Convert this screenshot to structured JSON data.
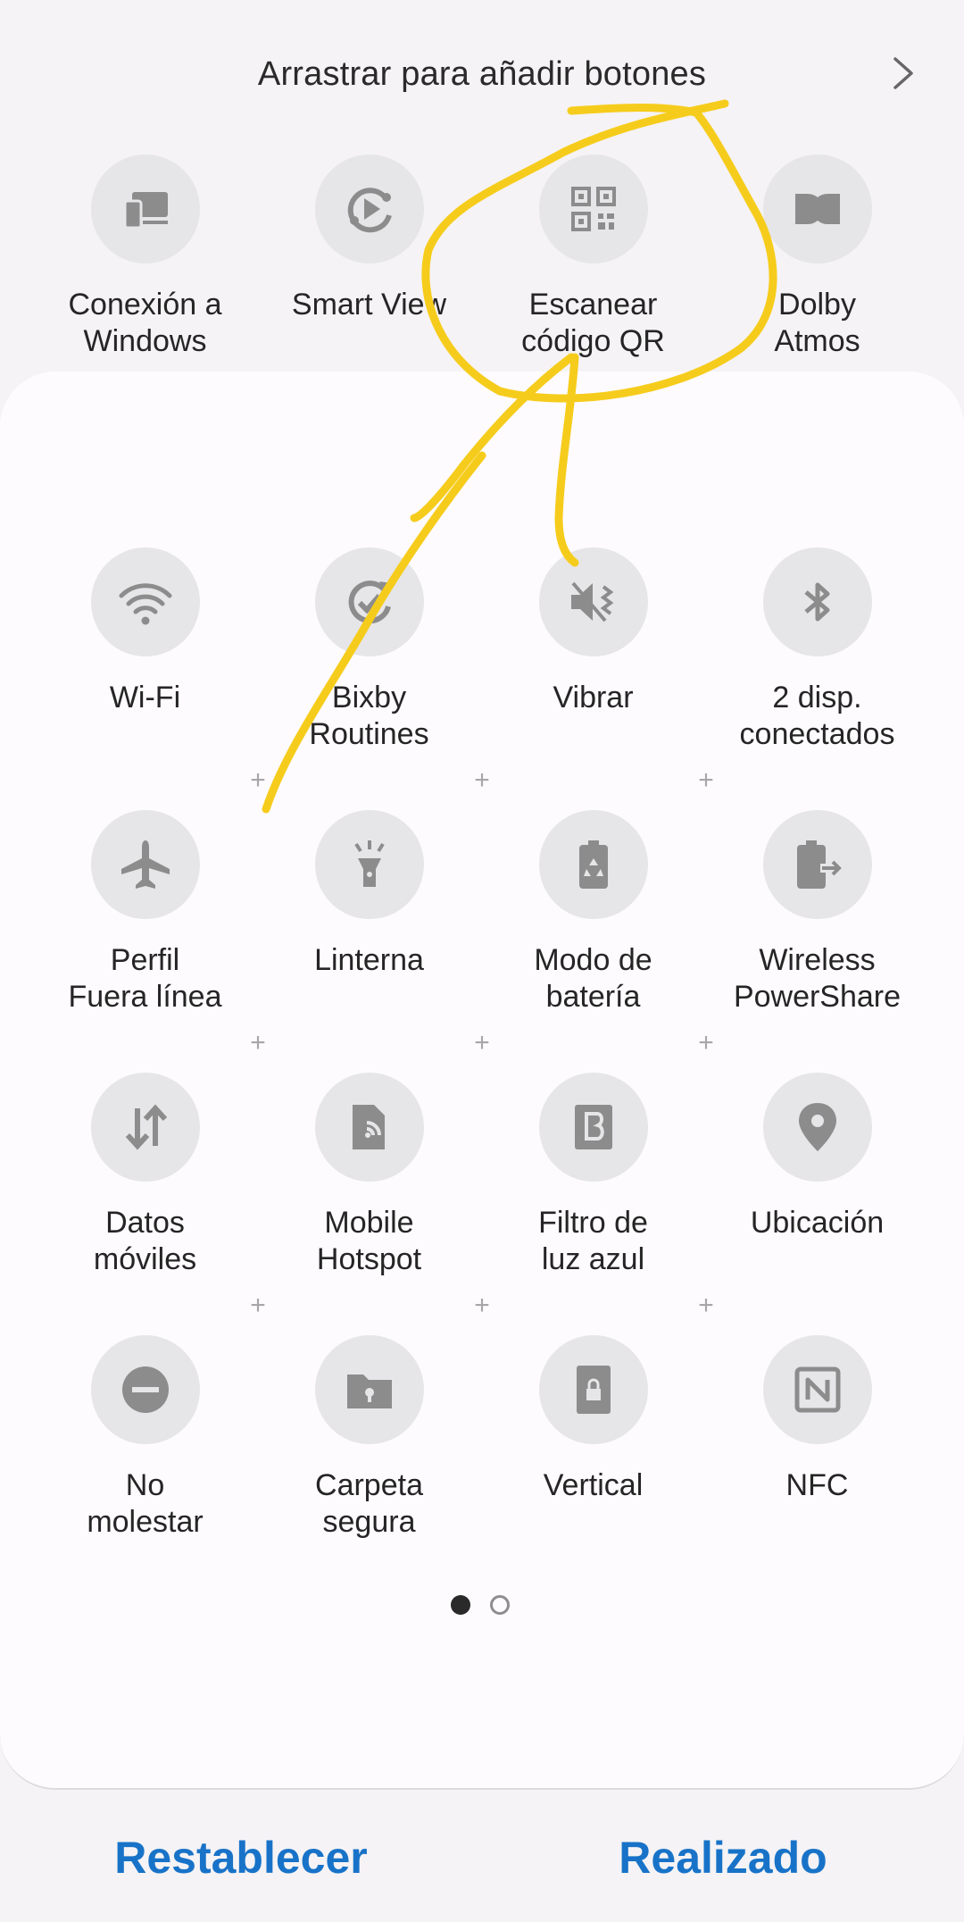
{
  "header": {
    "title": "Arrastrar para añadir botones"
  },
  "available_tiles": [
    {
      "label": "Conexión a\nWindows",
      "icon": "link-to-windows-icon"
    },
    {
      "label": "Smart View",
      "icon": "smart-view-icon"
    },
    {
      "label": "Escanear\ncódigo QR",
      "icon": "qr-code-icon"
    },
    {
      "label": "Dolby\nAtmos",
      "icon": "dolby-icon"
    }
  ],
  "active_tiles": [
    {
      "label": "Wi-Fi",
      "icon": "wifi-icon"
    },
    {
      "label": "Bixby\nRoutines",
      "icon": "bixby-routines-icon"
    },
    {
      "label": "Vibrar",
      "icon": "vibrate-icon"
    },
    {
      "label": "2 disp.\nconectados",
      "icon": "bluetooth-icon"
    },
    {
      "label": "Perfil\nFuera línea",
      "icon": "airplane-icon"
    },
    {
      "label": "Linterna",
      "icon": "flashlight-icon"
    },
    {
      "label": "Modo de\nbatería",
      "icon": "battery-mode-icon"
    },
    {
      "label": "Wireless\nPowerShare",
      "icon": "wireless-powershare-icon"
    },
    {
      "label": "Datos\nmóviles",
      "icon": "mobile-data-icon"
    },
    {
      "label": "Mobile\nHotspot",
      "icon": "hotspot-icon"
    },
    {
      "label": "Filtro de\nluz azul",
      "icon": "blue-light-filter-icon"
    },
    {
      "label": "Ubicación",
      "icon": "location-icon"
    },
    {
      "label": "No\nmolestar",
      "icon": "do-not-disturb-icon"
    },
    {
      "label": "Carpeta\nsegura",
      "icon": "secure-folder-icon"
    },
    {
      "label": "Vertical",
      "icon": "portrait-lock-icon"
    },
    {
      "label": "NFC",
      "icon": "nfc-icon"
    }
  ],
  "pagination": {
    "current": 1,
    "total": 2
  },
  "footer": {
    "reset_label": "Restablecer",
    "done_label": "Realizado"
  },
  "colors": {
    "accent": "#1873c8",
    "annotation": "#f6cc1c",
    "icon_gray": "#8c8c8c"
  }
}
